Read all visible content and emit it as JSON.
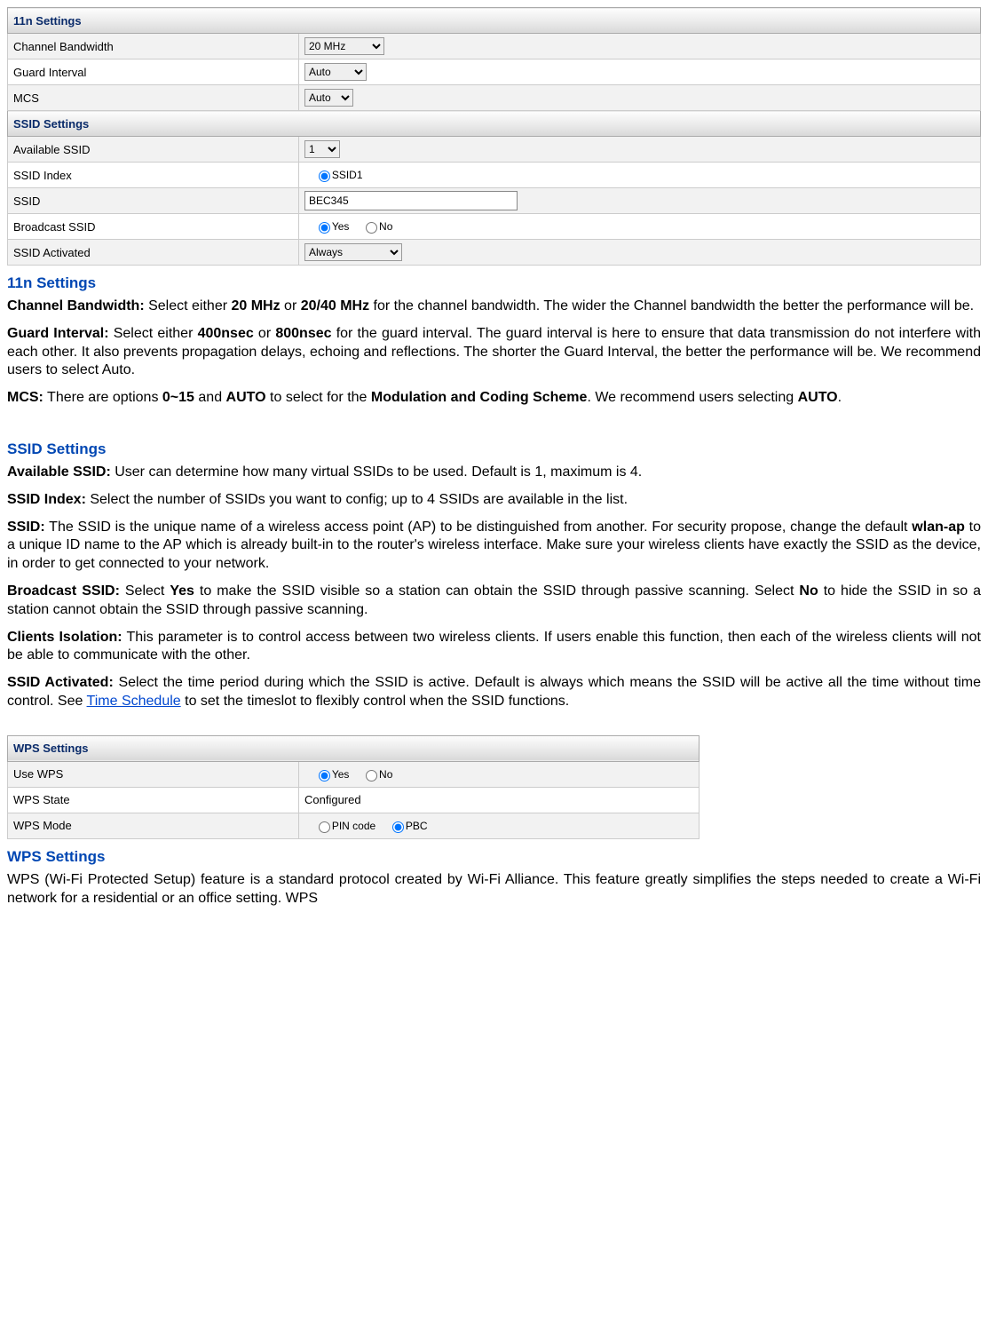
{
  "table1": {
    "head1": "11n Settings",
    "r1_label": "Channel Bandwidth",
    "r1_value": "20 MHz",
    "r2_label": "Guard Interval",
    "r2_value": "Auto",
    "r3_label": "MCS",
    "r3_value": "Auto",
    "head2": "SSID Settings",
    "r4_label": "Available SSID",
    "r4_value": "1",
    "r5_label": "SSID Index",
    "r5_value": "SSID1",
    "r6_label": "SSID",
    "r6_value": "BEC345",
    "r7_label": "Broadcast SSID",
    "r7_yes": "Yes",
    "r7_no": "No",
    "r8_label": "SSID Activated",
    "r8_value": "Always"
  },
  "doc": {
    "h1": "11n Settings",
    "p1_b": "Channel Bandwidth:",
    "p1_a": " Select either ",
    "p1_o1": "20 MHz",
    "p1_mid": " or ",
    "p1_o2": "20/40 MHz",
    "p1_end": " for the channel bandwidth. The wider the Channel bandwidth the better the performance will be.",
    "p2_b": "Guard Interval:",
    "p2_a": " Select either ",
    "p2_o1": "400nsec",
    "p2_mid": " or ",
    "p2_o2": "800nsec",
    "p2_end": " for the guard interval. The guard interval is here to ensure that data transmission do not interfere with each other. It also prevents propagation delays, echoing and reflections. The shorter the Guard Interval, the better the performance will be. We recommend users to select Auto.",
    "p3_b": "MCS:",
    "p3_a": " There are options ",
    "p3_o1": "0~15",
    "p3_mid": " and ",
    "p3_o2": "AUTO",
    "p3_c": " to select for the ",
    "p3_o3": "Modulation and Coding Scheme",
    "p3_d": ". We recommend users selecting ",
    "p3_o4": "AUTO",
    "p3_end": ".",
    "h2": "SSID Settings",
    "p4_b": "Available SSID:",
    "p4_end": " User can determine how many virtual SSIDs to be used. Default is 1, maximum is 4.",
    "p5_b": "SSID Index:",
    "p5_end": " Select the number of SSIDs you want to config; up to 4 SSIDs are available in the list.",
    "p6_b": "SSID:",
    "p6_a": " The SSID is the unique name of a wireless access point (AP) to be distinguished from another. For security propose, change the default ",
    "p6_o1": "wlan-ap",
    "p6_end": " to a unique ID name to the AP which is already built-in to the router's wireless interface. Make sure your wireless clients have exactly the SSID as the device, in order to get connected to your network.",
    "p7_b": "Broadcast SSID:",
    "p7_a": " Select ",
    "p7_o1": "Yes",
    "p7_mid": " to make the SSID visible so a station can obtain the SSID through passive scanning. Select ",
    "p7_o2": "No",
    "p7_end": " to hide the SSID in so a station cannot obtain the SSID through passive scanning.",
    "p8_b": "Clients Isolation:",
    "p8_end": " This parameter is to control access between two wireless clients. If users enable this function, then each of the wireless clients will not be able to communicate with the other.",
    "p9_b": "SSID Activated:",
    "p9_a": " Select the time period during which the SSID is active. Default is always which means the SSID will be active all the time without time control. See ",
    "p9_link": "Time Schedule",
    "p9_end": " to set the timeslot to flexibly control when the SSID functions."
  },
  "table2": {
    "head": "WPS Settings",
    "r1_label": "Use WPS",
    "r1_yes": "Yes",
    "r1_no": "No",
    "r2_label": "WPS State",
    "r2_value": "Configured",
    "r3_label": "WPS Mode",
    "r3_pin": "PIN code",
    "r3_pbc": "PBC"
  },
  "doc2": {
    "h3": "WPS Settings",
    "p10": "WPS (Wi-Fi Protected Setup) feature is a standard protocol created by Wi-Fi Alliance. This feature greatly simplifies the steps needed to create a Wi-Fi network for a residential or an office setting. WPS"
  }
}
